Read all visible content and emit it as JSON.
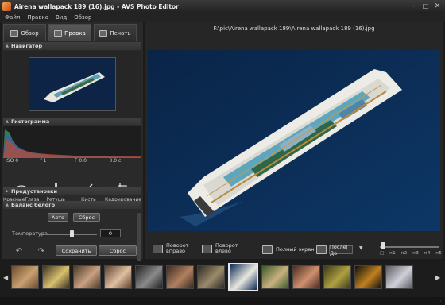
{
  "window": {
    "title": "Airena wallapack 189 (16).jpg - AVS Photo Editor",
    "minimize": "–",
    "maximize": "□",
    "close": "✕"
  },
  "menu": [
    "Файл",
    "Правка",
    "Вид",
    "Обзор"
  ],
  "tabs": [
    {
      "label": "Обзор",
      "icon": "folder-icon"
    },
    {
      "label": "Правка",
      "icon": "edit-icon"
    },
    {
      "label": "Печать",
      "icon": "print-icon"
    }
  ],
  "navigator": {
    "title": "Навигатор"
  },
  "histogram": {
    "title": "Гистограмма",
    "readouts": [
      "ISO 0",
      "f 1",
      "F 0.0",
      "0.0 c"
    ]
  },
  "tools": [
    {
      "label": "КрасныеГлаза",
      "icon": "eye-icon"
    },
    {
      "label": "Ретушь",
      "icon": "retouch-icon"
    },
    {
      "label": "Кисть",
      "icon": "brush-icon"
    },
    {
      "label": "Кадрирование",
      "icon": "crop-icon"
    }
  ],
  "presets": {
    "title": "Предустановки"
  },
  "white_balance": {
    "title": "Баланс белого",
    "auto_label": "Авто",
    "reset_label": "Сброс",
    "temperature_label": "Температура",
    "temperature_value": "0",
    "temperature_level": 0.5
  },
  "bottom_buttons": {
    "save": "Сохранить",
    "reset": "Сброс"
  },
  "file_path": "F:\\pic\\Airena wallapack 189\\Airena wallapack 189 (16).jpg",
  "toolbar": {
    "rotate_right": "Поворот\nвправо",
    "rotate_left": "Поворот\nвлево",
    "fullscreen": "Полный экран",
    "before_after": "После|До"
  },
  "zoom": {
    "labels": [
      "□",
      "×1",
      "×2",
      "×3",
      "×4",
      "×5"
    ],
    "level": 0
  },
  "filmstrip": {
    "count": 13,
    "selected_index": 7
  },
  "colors": {
    "accent": "#e8e8e8",
    "panel": "#2a2a2a",
    "sea": "#0b2346"
  }
}
